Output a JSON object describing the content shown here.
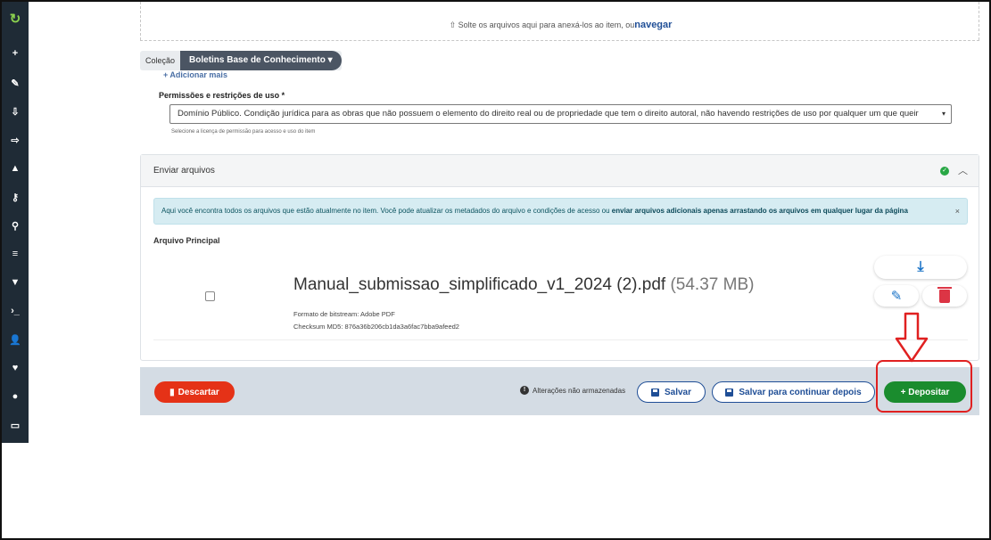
{
  "sidebar": {
    "icons": [
      "logo-icon",
      "plus-icon",
      "pencil-icon",
      "import-icon",
      "export-icon",
      "bell-icon",
      "key-icon",
      "search-icon",
      "list-icon",
      "filter-icon",
      "terminal-icon",
      "user-icon",
      "heart-icon",
      "info-icon",
      "inbox-icon"
    ],
    "glyphs": [
      "↻",
      "+",
      "✎",
      "⇩",
      "⇨",
      "▲",
      "⚷",
      "⚲",
      "≡",
      "▼",
      "›_",
      "👤",
      "♥",
      "●",
      "▭"
    ]
  },
  "dropzone": {
    "text": "Solte os arquivos aqui para anexá-los ao item, ou",
    "link": "navegar"
  },
  "collection": {
    "label": "Coleção",
    "value": "Boletins Base de Conhecimento ▾"
  },
  "add_more": "+ Adicionar mais",
  "permissions": {
    "label": "Permissões e restrições de uso *",
    "value": "Domínio Público. Condição jurídica para as obras que não possuem o elemento do direito real ou de propriedade que tem o direito autoral, não havendo restrições de uso por qualquer um que queir",
    "hint": "Selecione a licença de permissão para acesso e uso do item"
  },
  "upload_panel": {
    "title": "Enviar arquivos",
    "alert_text": "Aqui você encontra todos os arquivos que estão atualmente no item. Você pode atualizar os metadados do arquivo e condições de acesso ou ",
    "alert_bold": "enviar arquivos adicionais apenas arrastando os arquivos em qualquer lugar da página",
    "alert_close": "×",
    "main_file_label": "Arquivo Principal",
    "file": {
      "name": "Manual_submissao_simplificado_v1_2024 (2).pdf",
      "size": "(54.37 MB)",
      "format": "Formato de bitstream: Adobe PDF",
      "checksum": "Checksum MD5: 876a36b206cb1da3a6fac7bba9afeed2"
    }
  },
  "footer": {
    "discard": "Descartar",
    "unsaved": "Alterações não armazenadas",
    "save": "Salvar",
    "save_later": "Salvar para continuar depois",
    "deposit": "+ Depositar"
  },
  "colors": {
    "sidebar_bg": "#1f2b36",
    "deposit_green": "#1a8c2e",
    "discard_red": "#e53217",
    "primary_blue": "#1f4e96",
    "highlight_red": "#e02020"
  }
}
